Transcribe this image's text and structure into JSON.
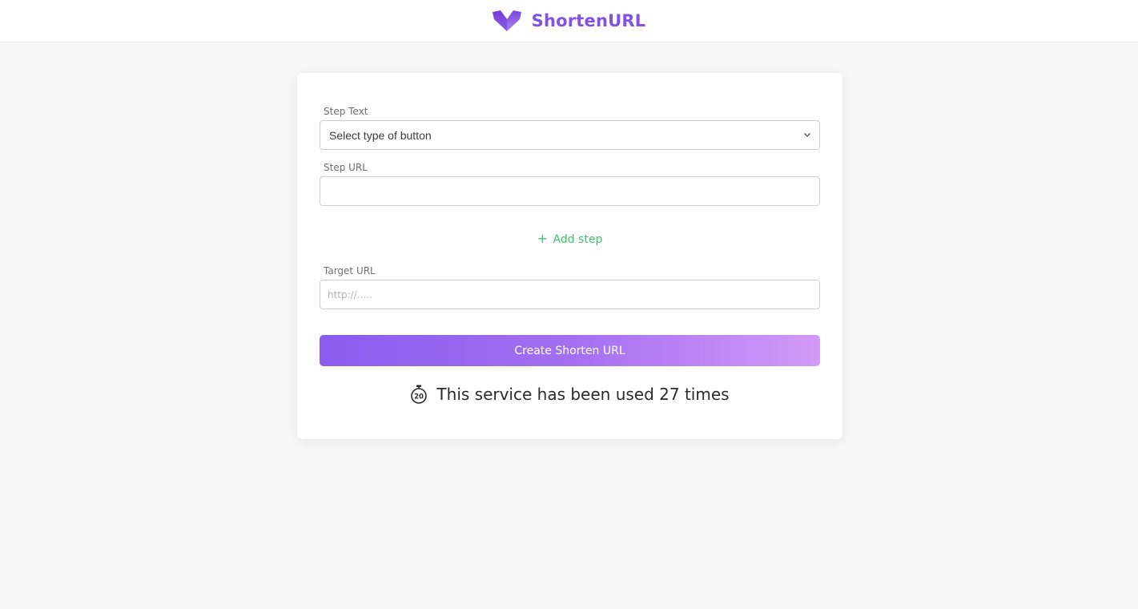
{
  "header": {
    "brand_name": "ShortenURL",
    "logo_icon": "purple-v-heart-logo",
    "brand_color": "#8352e3"
  },
  "form": {
    "step_text_label": "Step Text",
    "step_text_select": {
      "selected": "Select type of button"
    },
    "step_url_label": "Step URL",
    "step_url_value": "",
    "add_step_icon": "plus-icon",
    "add_step_label": "Add step",
    "target_url_label": "Target URL",
    "target_url_placeholder": "http://.....",
    "create_button_label": "Create Shorten URL"
  },
  "usage": {
    "icon": "stopwatch-icon",
    "text": "This service has been used 27 times"
  },
  "colors": {
    "accent": "#8352e3",
    "add_step_green": "#3ec46d",
    "gradient_start": "#8a5cf0",
    "gradient_end": "#d39af8"
  }
}
